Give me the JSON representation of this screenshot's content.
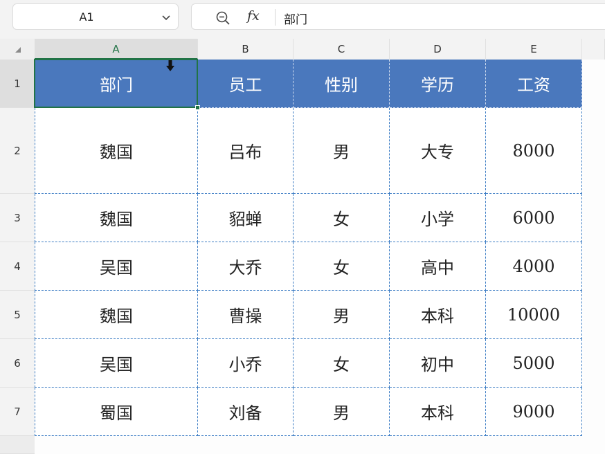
{
  "formula_bar": {
    "name_box": "A1",
    "fx_label": "fx",
    "content": "部门"
  },
  "columns": [
    "A",
    "B",
    "C",
    "D",
    "E"
  ],
  "rows": [
    "1",
    "2",
    "3",
    "4",
    "5",
    "6",
    "7"
  ],
  "table": {
    "header": [
      "部门",
      "员工",
      "性别",
      "学历",
      "工资"
    ],
    "body": [
      [
        "魏国",
        "吕布",
        "男",
        "大专",
        "8000"
      ],
      [
        "魏国",
        "貂蝉",
        "女",
        "小学",
        "6000"
      ],
      [
        "吴国",
        "大乔",
        "女",
        "高中",
        "4000"
      ],
      [
        "魏国",
        "曹操",
        "男",
        "本科",
        "10000"
      ],
      [
        "吴国",
        "小乔",
        "女",
        "初中",
        "5000"
      ],
      [
        "蜀国",
        "刘备",
        "男",
        "本科",
        "9000"
      ]
    ]
  },
  "selection": {
    "cell": "A1"
  },
  "colors": {
    "header_fill": "#4a78bd",
    "selection": "#217346",
    "border": "#3b7cc4"
  },
  "icons": [
    "chevron-down-icon",
    "zoom-out-icon",
    "cursor-icon"
  ]
}
